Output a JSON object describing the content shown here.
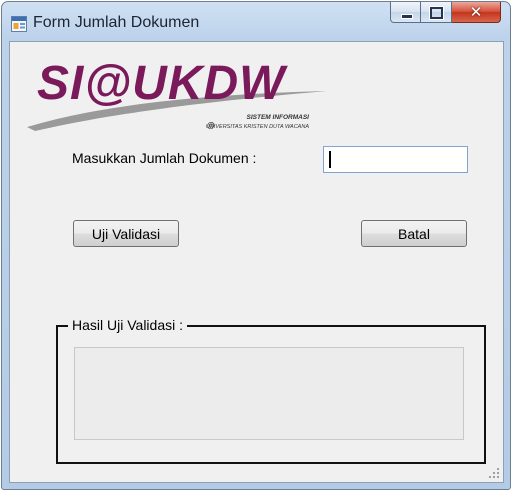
{
  "window": {
    "title": "Form Jumlah Dokumen",
    "icon": "form-window-icon",
    "controls": {
      "minimize": "minimize-icon",
      "maximize": "maximize-icon",
      "close": "close-icon",
      "close_glyph": "✕"
    }
  },
  "logo": {
    "main_text": "SI@UKDW",
    "tagline_top": "SISTEM INFORMASI",
    "tagline_bottom": "UNIVERSITAS KRISTEN DUTA WACANA",
    "at_symbol": "@",
    "colors": {
      "text": "#7a1a5b",
      "swoosh": "#9a9a9a"
    }
  },
  "form": {
    "jumlah_label": "Masukkan Jumlah Dokumen :",
    "jumlah_value": "",
    "uji_button": "Uji Validasi",
    "batal_button": "Batal",
    "group_title": "Hasil Uji Validasi :",
    "result_text": ""
  },
  "colors": {
    "frame": "#b9cfe8",
    "client_bg": "#f0f0f0",
    "close_button": "#c8452c"
  }
}
